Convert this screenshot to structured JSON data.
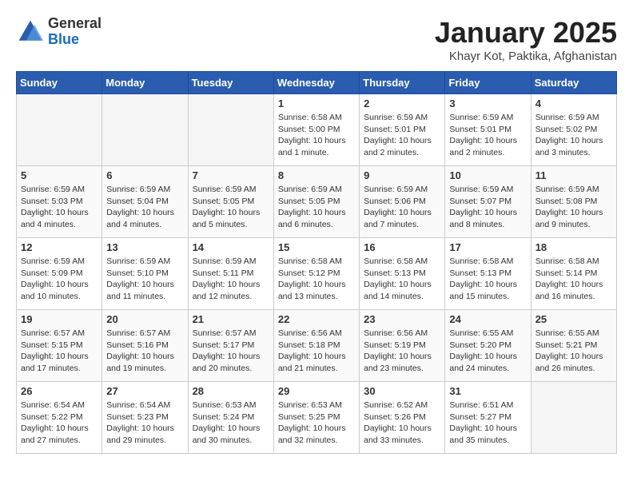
{
  "header": {
    "logo": {
      "general": "General",
      "blue": "Blue"
    },
    "title": "January 2025",
    "subtitle": "Khayr Kot, Paktika, Afghanistan"
  },
  "calendar": {
    "days_of_week": [
      "Sunday",
      "Monday",
      "Tuesday",
      "Wednesday",
      "Thursday",
      "Friday",
      "Saturday"
    ],
    "weeks": [
      [
        {
          "day": "",
          "info": ""
        },
        {
          "day": "",
          "info": ""
        },
        {
          "day": "",
          "info": ""
        },
        {
          "day": "1",
          "info": "Sunrise: 6:58 AM\nSunset: 5:00 PM\nDaylight: 10 hours\nand 1 minute."
        },
        {
          "day": "2",
          "info": "Sunrise: 6:59 AM\nSunset: 5:01 PM\nDaylight: 10 hours\nand 2 minutes."
        },
        {
          "day": "3",
          "info": "Sunrise: 6:59 AM\nSunset: 5:01 PM\nDaylight: 10 hours\nand 2 minutes."
        },
        {
          "day": "4",
          "info": "Sunrise: 6:59 AM\nSunset: 5:02 PM\nDaylight: 10 hours\nand 3 minutes."
        }
      ],
      [
        {
          "day": "5",
          "info": "Sunrise: 6:59 AM\nSunset: 5:03 PM\nDaylight: 10 hours\nand 4 minutes."
        },
        {
          "day": "6",
          "info": "Sunrise: 6:59 AM\nSunset: 5:04 PM\nDaylight: 10 hours\nand 4 minutes."
        },
        {
          "day": "7",
          "info": "Sunrise: 6:59 AM\nSunset: 5:05 PM\nDaylight: 10 hours\nand 5 minutes."
        },
        {
          "day": "8",
          "info": "Sunrise: 6:59 AM\nSunset: 5:05 PM\nDaylight: 10 hours\nand 6 minutes."
        },
        {
          "day": "9",
          "info": "Sunrise: 6:59 AM\nSunset: 5:06 PM\nDaylight: 10 hours\nand 7 minutes."
        },
        {
          "day": "10",
          "info": "Sunrise: 6:59 AM\nSunset: 5:07 PM\nDaylight: 10 hours\nand 8 minutes."
        },
        {
          "day": "11",
          "info": "Sunrise: 6:59 AM\nSunset: 5:08 PM\nDaylight: 10 hours\nand 9 minutes."
        }
      ],
      [
        {
          "day": "12",
          "info": "Sunrise: 6:59 AM\nSunset: 5:09 PM\nDaylight: 10 hours\nand 10 minutes."
        },
        {
          "day": "13",
          "info": "Sunrise: 6:59 AM\nSunset: 5:10 PM\nDaylight: 10 hours\nand 11 minutes."
        },
        {
          "day": "14",
          "info": "Sunrise: 6:59 AM\nSunset: 5:11 PM\nDaylight: 10 hours\nand 12 minutes."
        },
        {
          "day": "15",
          "info": "Sunrise: 6:58 AM\nSunset: 5:12 PM\nDaylight: 10 hours\nand 13 minutes."
        },
        {
          "day": "16",
          "info": "Sunrise: 6:58 AM\nSunset: 5:13 PM\nDaylight: 10 hours\nand 14 minutes."
        },
        {
          "day": "17",
          "info": "Sunrise: 6:58 AM\nSunset: 5:13 PM\nDaylight: 10 hours\nand 15 minutes."
        },
        {
          "day": "18",
          "info": "Sunrise: 6:58 AM\nSunset: 5:14 PM\nDaylight: 10 hours\nand 16 minutes."
        }
      ],
      [
        {
          "day": "19",
          "info": "Sunrise: 6:57 AM\nSunset: 5:15 PM\nDaylight: 10 hours\nand 17 minutes."
        },
        {
          "day": "20",
          "info": "Sunrise: 6:57 AM\nSunset: 5:16 PM\nDaylight: 10 hours\nand 19 minutes."
        },
        {
          "day": "21",
          "info": "Sunrise: 6:57 AM\nSunset: 5:17 PM\nDaylight: 10 hours\nand 20 minutes."
        },
        {
          "day": "22",
          "info": "Sunrise: 6:56 AM\nSunset: 5:18 PM\nDaylight: 10 hours\nand 21 minutes."
        },
        {
          "day": "23",
          "info": "Sunrise: 6:56 AM\nSunset: 5:19 PM\nDaylight: 10 hours\nand 23 minutes."
        },
        {
          "day": "24",
          "info": "Sunrise: 6:55 AM\nSunset: 5:20 PM\nDaylight: 10 hours\nand 24 minutes."
        },
        {
          "day": "25",
          "info": "Sunrise: 6:55 AM\nSunset: 5:21 PM\nDaylight: 10 hours\nand 26 minutes."
        }
      ],
      [
        {
          "day": "26",
          "info": "Sunrise: 6:54 AM\nSunset: 5:22 PM\nDaylight: 10 hours\nand 27 minutes."
        },
        {
          "day": "27",
          "info": "Sunrise: 6:54 AM\nSunset: 5:23 PM\nDaylight: 10 hours\nand 29 minutes."
        },
        {
          "day": "28",
          "info": "Sunrise: 6:53 AM\nSunset: 5:24 PM\nDaylight: 10 hours\nand 30 minutes."
        },
        {
          "day": "29",
          "info": "Sunrise: 6:53 AM\nSunset: 5:25 PM\nDaylight: 10 hours\nand 32 minutes."
        },
        {
          "day": "30",
          "info": "Sunrise: 6:52 AM\nSunset: 5:26 PM\nDaylight: 10 hours\nand 33 minutes."
        },
        {
          "day": "31",
          "info": "Sunrise: 6:51 AM\nSunset: 5:27 PM\nDaylight: 10 hours\nand 35 minutes."
        },
        {
          "day": "",
          "info": ""
        }
      ]
    ]
  }
}
